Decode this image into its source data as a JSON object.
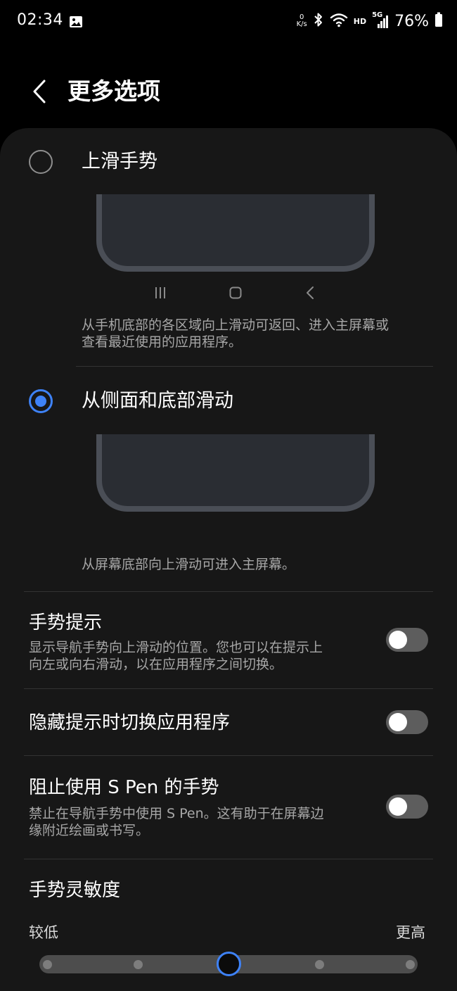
{
  "status_bar": {
    "time": "02:34",
    "net_speed_value": "0",
    "net_speed_unit": "K/s",
    "hd_label": "HD",
    "network_type": "5G",
    "battery_percent": "76%",
    "icons": [
      "image-icon",
      "bluetooth-icon",
      "wifi-icon",
      "signal-icon",
      "battery-icon"
    ]
  },
  "header": {
    "title": "更多选项",
    "back_icon": "chevron-left-icon"
  },
  "gesture_options": [
    {
      "label": "上滑手势",
      "selected": false,
      "description_line1": "从手机底部的各区域向上滑动可返回、进入主屏幕或",
      "description_line2": "查看最近使用的应用程序。",
      "nav_icons": [
        "recent-apps-icon",
        "home-icon",
        "back-icon"
      ]
    },
    {
      "label": "从侧面和底部滑动",
      "selected": true,
      "description_line1": "从屏幕底部向上滑动可进入主屏幕。"
    }
  ],
  "settings": [
    {
      "title": "手势提示",
      "description_line1": "显示导航手势向上滑动的位置。您也可以在提示上",
      "description_line2": "向左或向右滑动，以在应用程序之间切换。",
      "enabled": false
    },
    {
      "title": "隐藏提示时切换应用程序",
      "enabled": false
    },
    {
      "title": "阻止使用 S Pen 的手势",
      "description_line1": "禁止在导航手势中使用 S Pen。这有助于在屏幕边",
      "description_line2": "缘附近绘画或书写。",
      "enabled": false
    }
  ],
  "sensitivity": {
    "title": "手势灵敏度",
    "low_label": "较低",
    "high_label": "更高",
    "steps": 5,
    "current_step": 2
  },
  "colors": {
    "accent": "#3e82f7",
    "background": "#000000",
    "card": "#171717",
    "secondary_text": "#a7a7a7"
  }
}
